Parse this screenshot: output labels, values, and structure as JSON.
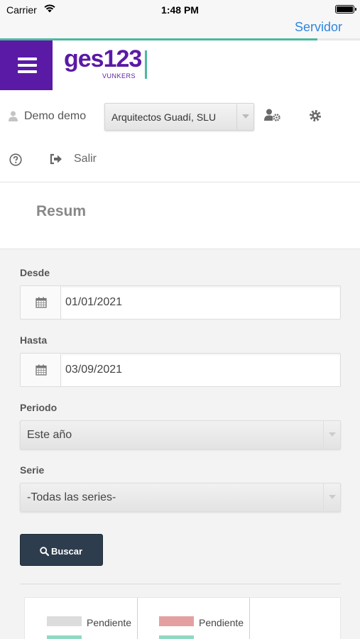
{
  "status_bar": {
    "carrier": "Carrier",
    "time": "1:48 PM"
  },
  "nav": {
    "server_label": "Servidor"
  },
  "brand": {
    "logo_text": "ges123",
    "logo_subtext": "VUNKERS",
    "accent_color": "#5a1aa6",
    "secondary_color": "#4cb8a0"
  },
  "user": {
    "name": "Demo demo",
    "company": "Arquitectos Guadí, SLU"
  },
  "actions": {
    "logout_label": "Salir"
  },
  "page": {
    "title": "Resum"
  },
  "filters": {
    "from_label": "Desde",
    "from_value": "01/01/2021",
    "to_label": "Hasta",
    "to_value": "03/09/2021",
    "period_label": "Periodo",
    "period_value": "Este año",
    "series_label": "Serie",
    "series_value": "-Todas las series-",
    "search_label": "Buscar"
  },
  "legend": {
    "items": [
      {
        "label": "Pendiente",
        "color": "#dcdcdc"
      },
      {
        "label": "Pendiente",
        "color": "#e4a0a0"
      }
    ],
    "next_colors": [
      "#8fd9c2",
      "#8fd9c2"
    ]
  },
  "icons": {
    "menu": "hamburger-icon",
    "wifi": "wifi-icon",
    "battery": "battery-icon",
    "user": "user-icon",
    "user_settings": "user-cog-icon",
    "settings": "gear-icon",
    "help": "question-circle-icon",
    "logout": "sign-out-icon",
    "calendar": "calendar-icon",
    "search": "search-icon"
  }
}
